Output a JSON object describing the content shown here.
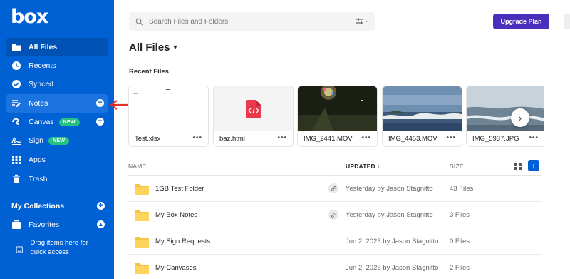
{
  "sidebar": {
    "logo": "box",
    "items": [
      {
        "label": "All Files",
        "icon": "folder-icon"
      },
      {
        "label": "Recents",
        "icon": "clock-icon"
      },
      {
        "label": "Synced",
        "icon": "check-circle-icon"
      },
      {
        "label": "Notes",
        "icon": "notes-icon"
      },
      {
        "label": "Canvas",
        "icon": "canvas-icon",
        "badge": "NEW"
      },
      {
        "label": "Sign",
        "icon": "signature-icon",
        "badge": "NEW"
      },
      {
        "label": "Apps",
        "icon": "grid-icon"
      },
      {
        "label": "Trash",
        "icon": "trash-icon"
      }
    ],
    "collections_label": "My Collections",
    "favorites_label": "Favorites",
    "drag_hint": "Drag items here for quick access",
    "color": "#0061d5"
  },
  "search": {
    "placeholder": "Search Files and Folders"
  },
  "upgrade_label": "Upgrade Plan",
  "upgrade_color": "#4a2fbd",
  "page_title": "All Files",
  "recent_label": "Recent Files",
  "recent_files": [
    {
      "name": "Test.xlsx",
      "more": "•••"
    },
    {
      "name": "baz.html",
      "more": "•••"
    },
    {
      "name": "IMG_2441.MOV",
      "more": "•••"
    },
    {
      "name": "IMG_4453.MOV",
      "more": "•••"
    },
    {
      "name": "IMG_5937.JPG",
      "more": "•••"
    }
  ],
  "table": {
    "col_name": "NAME",
    "col_updated": "UPDATED ↓",
    "col_size": "SIZE",
    "rows": [
      {
        "name": "1GB Test Folder",
        "updated": "Yesterday by Jason Stagnitto",
        "size": "43 Files",
        "shared": true
      },
      {
        "name": "My Box Notes",
        "updated": "Yesterday by Jason Stagnitto",
        "size": "3 Files",
        "shared": true
      },
      {
        "name": "My Sign Requests",
        "updated": "Jun 2, 2023 by Jason Stagnitto",
        "size": "0 Files",
        "shared": false
      },
      {
        "name": "My Canvases",
        "updated": "Jun 2, 2023 by Jason Stagnitto",
        "size": "2 Files",
        "shared": false
      }
    ]
  }
}
